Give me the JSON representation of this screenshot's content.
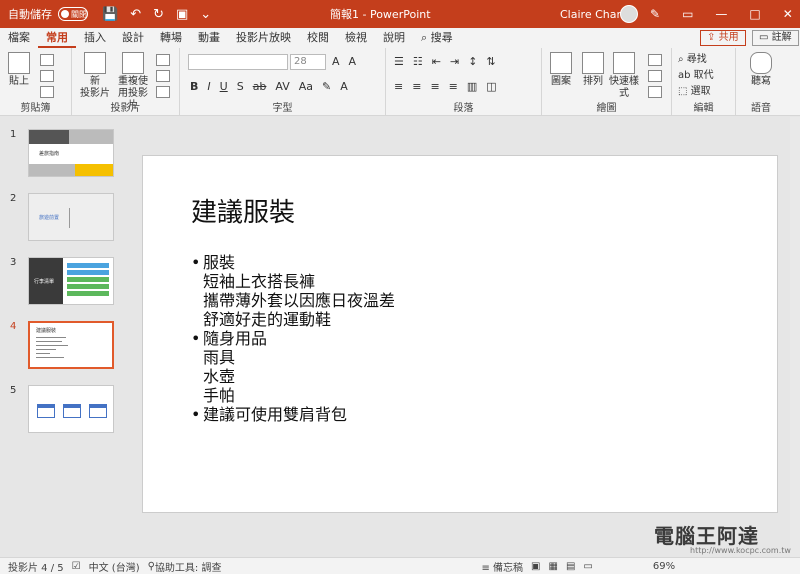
{
  "titlebar": {
    "autosave_label": "自動儲存",
    "autosave_state": "關閉",
    "doc_title": "簡報1 - PowerPoint",
    "user_name": "Claire Chang"
  },
  "tabs": [
    "檔案",
    "常用",
    "插入",
    "設計",
    "轉場",
    "動畫",
    "投影片放映",
    "校閱",
    "檢視",
    "說明",
    "搜尋"
  ],
  "share_label": "共用",
  "comment_label": "註解",
  "ribbon": {
    "clipboard": {
      "paste": "貼上",
      "group": "剪貼簿"
    },
    "slides": {
      "new_slide_1": "新",
      "new_slide_2": "投影片",
      "reuse_1": "重複使",
      "reuse_2": "用投影片",
      "group": "投影片"
    },
    "font": {
      "font_name": "",
      "font_size": "28",
      "group": "字型"
    },
    "paragraph": {
      "group": "段落"
    },
    "drawing": {
      "shapes": "圖案",
      "arrange": "排列",
      "quick_styles_1": "快速樣",
      "quick_styles_2": "式",
      "group": "繪圖"
    },
    "editing": {
      "find": "尋找",
      "replace": "取代",
      "select": "選取",
      "group": "編輯"
    },
    "voice": {
      "dictate": "聽寫",
      "group": "語音"
    }
  },
  "thumbnails": [
    {
      "num": "1",
      "title": "差旅指南"
    },
    {
      "num": "2",
      "title": "旅遊前置"
    },
    {
      "num": "3",
      "title": "行李清單"
    },
    {
      "num": "4",
      "title": "建議服裝"
    },
    {
      "num": "5",
      "title": ""
    }
  ],
  "slide": {
    "title": "建議服裝",
    "bullets": [
      {
        "text": "服裝",
        "subs": [
          "短袖上衣搭長褲",
          "攜帶薄外套以因應日夜溫差",
          "舒適好走的運動鞋"
        ]
      },
      {
        "text": "隨身用品",
        "subs": [
          "雨具",
          "水壺",
          "手帕"
        ]
      },
      {
        "text": "建議可使用雙肩背包",
        "subs": []
      }
    ]
  },
  "statusbar": {
    "slide_count": "投影片 4 / 5",
    "language": "中文 (台灣)",
    "accessibility": "協助工具: 調查",
    "notes": "備忘稿",
    "zoom": "69%"
  },
  "watermark": {
    "text": "電腦王阿達",
    "url": "http://www.kocpc.com.tw"
  },
  "colors": {
    "accent": "#c43e1c",
    "thumb_active": "#e15a2b"
  }
}
